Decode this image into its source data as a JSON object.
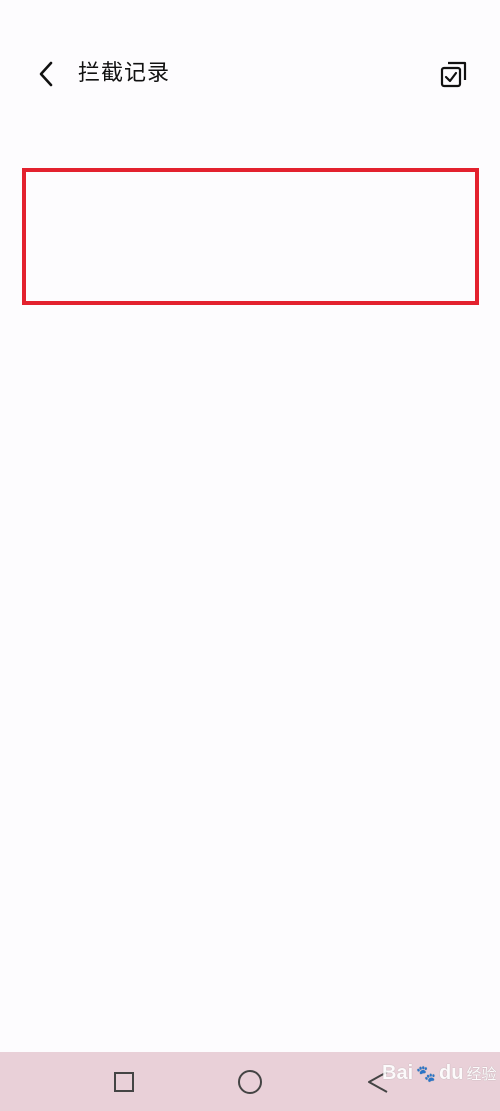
{
  "header": {
    "title": "拦截记录",
    "back_icon": "chevron-left-icon",
    "action_icon": "multi-select-icon"
  },
  "highlight": {
    "color": "#e3212e"
  },
  "nav_bar": {
    "background": "#e9d0d8",
    "items": [
      {
        "icon": "square-icon"
      },
      {
        "icon": "circle-icon"
      },
      {
        "icon": "triangle-back-icon"
      }
    ]
  },
  "watermark": {
    "brand": "Bai",
    "paw": "du",
    "suffix": "经验"
  }
}
